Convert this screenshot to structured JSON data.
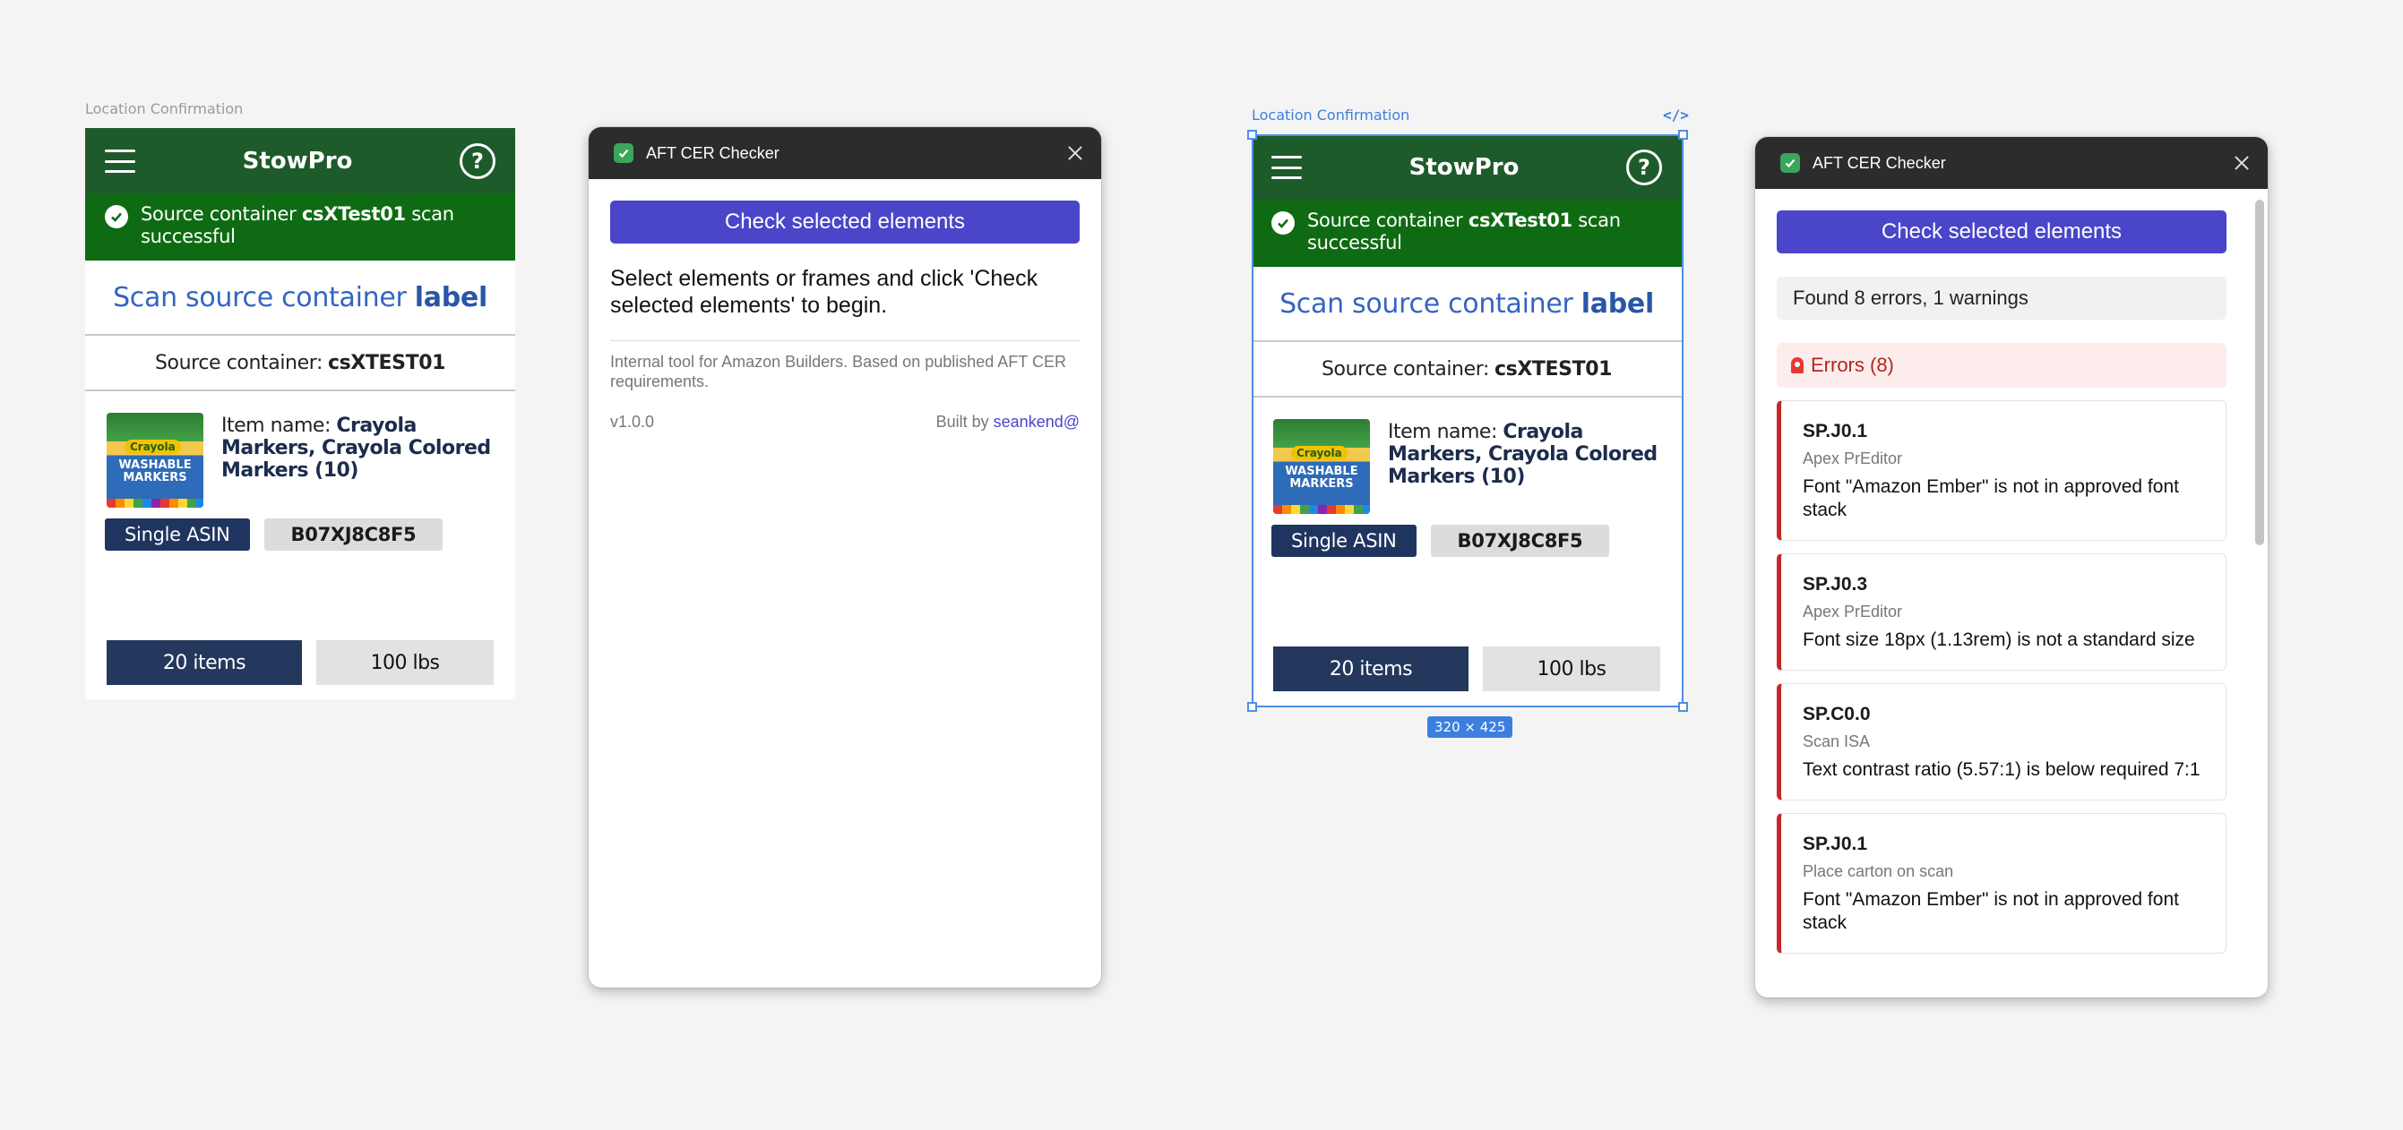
{
  "frame_label": "Location Confirmation",
  "app": {
    "title": "StowPro",
    "help_glyph": "?",
    "banner_pre": "Source container ",
    "banner_bold": "csXTest01",
    "banner_post": " scan successful",
    "scan_pre": "Scan source container ",
    "scan_bold": "label",
    "source_label": "Source container:",
    "source_value": "csXTEST01",
    "thumb_brand": "Crayola",
    "thumb_text": "WASHABLE MARKERS",
    "item_label": "Item name: ",
    "item_value": "Crayola Markers, Crayola Colored Markers (10)",
    "tag_type": "Single ASIN",
    "tag_asin": "B07XJ8C8F5",
    "qty": "20 items",
    "weight": "100 lbs"
  },
  "selection": {
    "size_badge": "320 × 425",
    "code_glyph": "</>"
  },
  "plugin": {
    "title": "AFT CER Checker",
    "check_button": "Check selected elements",
    "instructions": "Select elements or frames and click 'Check selected elements' to begin.",
    "note": "Internal tool for Amazon Builders. Based on published AFT CER requirements.",
    "version": "v1.0.0",
    "built_by": "Built by",
    "author": "seankend@"
  },
  "results": {
    "summary": "Found 8 errors, 1 warnings",
    "errors_heading": "Errors (8)",
    "errors": [
      {
        "code": "SP.J0.1",
        "location": "Apex PrEditor",
        "message": "Font \"Amazon Ember\" is not in approved font stack"
      },
      {
        "code": "SP.J0.3",
        "location": "Apex PrEditor",
        "message": "Font size 18px (1.13rem) is not a standard size"
      },
      {
        "code": "SP.C0.0",
        "location": "Scan ISA",
        "message": "Text contrast ratio (5.57:1) is below required 7:1"
      },
      {
        "code": "SP.J0.1",
        "location": "Place carton on scan",
        "message": "Font \"Amazon Ember\" is not in approved font stack"
      }
    ]
  },
  "colors": {
    "app_header": "#1d5b2a",
    "banner": "#0f6b13",
    "accent": "#4a45c9",
    "navy": "#24375c",
    "error": "#c62828"
  }
}
